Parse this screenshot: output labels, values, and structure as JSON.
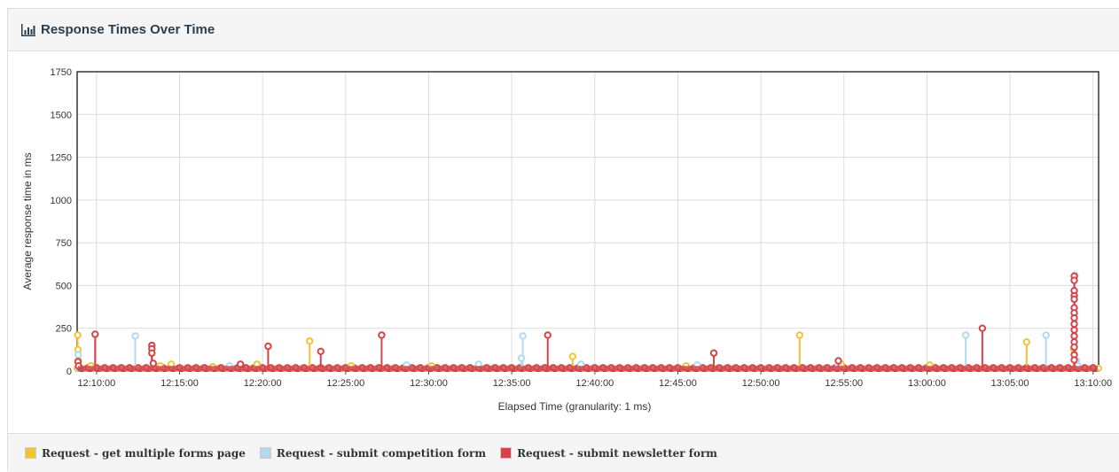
{
  "panel": {
    "title": "Response Times Over Time",
    "title_icon": "bar-chart-icon"
  },
  "chart_data": {
    "type": "line",
    "xlabel": "Elapsed Time (granularity: 1 ms)",
    "ylabel": "Average response time in ms",
    "x_domain": [
      "12:08:50",
      "13:10:20"
    ],
    "ylim": [
      0,
      1750
    ],
    "y_ticks": [
      0,
      250,
      500,
      750,
      1000,
      1250,
      1500,
      1750
    ],
    "x_ticks": [
      "12:10:00",
      "12:15:00",
      "12:20:00",
      "12:25:00",
      "12:30:00",
      "12:35:00",
      "12:40:00",
      "12:45:00",
      "12:50:00",
      "12:55:00",
      "13:00:00",
      "13:05:00",
      "13:10:00"
    ],
    "grid": true,
    "legend_position": "bottom",
    "baseline_value": 20,
    "series": [
      {
        "name": "Request - get multiple forms page",
        "color": "#f0c33a",
        "points": [
          {
            "t": "12:08:52",
            "v": 210
          },
          {
            "t": "12:08:53",
            "v": 125
          },
          {
            "t": "12:08:55",
            "v": 60
          },
          {
            "t": "12:09:40",
            "v": 30
          },
          {
            "t": "12:13:50",
            "v": 30
          },
          {
            "t": "12:14:30",
            "v": 40
          },
          {
            "t": "12:17:00",
            "v": 25
          },
          {
            "t": "12:19:40",
            "v": 40
          },
          {
            "t": "12:22:50",
            "v": 175
          },
          {
            "t": "12:25:20",
            "v": 30
          },
          {
            "t": "12:30:10",
            "v": 30
          },
          {
            "t": "12:38:40",
            "v": 85
          },
          {
            "t": "12:45:30",
            "v": 30
          },
          {
            "t": "12:52:20",
            "v": 210
          },
          {
            "t": "12:54:50",
            "v": 40
          },
          {
            "t": "13:00:10",
            "v": 35
          },
          {
            "t": "13:06:00",
            "v": 170
          },
          {
            "t": "13:08:50",
            "v": 130
          }
        ]
      },
      {
        "name": "Request - submit competition form",
        "color": "#b3d9f0",
        "points": [
          {
            "t": "12:08:54",
            "v": 95
          },
          {
            "t": "12:12:20",
            "v": 205
          },
          {
            "t": "12:18:00",
            "v": 30
          },
          {
            "t": "12:28:40",
            "v": 35
          },
          {
            "t": "12:33:00",
            "v": 40
          },
          {
            "t": "12:35:40",
            "v": 205
          },
          {
            "t": "12:35:35",
            "v": 75
          },
          {
            "t": "12:39:10",
            "v": 40
          },
          {
            "t": "12:46:10",
            "v": 35
          },
          {
            "t": "12:54:40",
            "v": 30
          },
          {
            "t": "13:02:20",
            "v": 210
          },
          {
            "t": "13:07:10",
            "v": 210
          },
          {
            "t": "13:08:55",
            "v": 560
          },
          {
            "t": "13:09:00",
            "v": 60
          },
          {
            "t": "13:09:05",
            "v": 30
          }
        ]
      },
      {
        "name": "Request - submit newsletter form",
        "color": "#d4454a",
        "points": [
          {
            "t": "12:08:53",
            "v": 55
          },
          {
            "t": "12:08:55",
            "v": 30
          },
          {
            "t": "12:09:55",
            "v": 215
          },
          {
            "t": "12:13:20",
            "v": 150
          },
          {
            "t": "12:13:20",
            "v": 130
          },
          {
            "t": "12:13:20",
            "v": 105
          },
          {
            "t": "12:13:25",
            "v": 45
          },
          {
            "t": "12:18:40",
            "v": 40
          },
          {
            "t": "12:20:20",
            "v": 145
          },
          {
            "t": "12:23:30",
            "v": 115
          },
          {
            "t": "12:27:10",
            "v": 210
          },
          {
            "t": "12:37:10",
            "v": 210
          },
          {
            "t": "12:47:10",
            "v": 105
          },
          {
            "t": "12:54:40",
            "v": 60
          },
          {
            "t": "13:03:20",
            "v": 250
          },
          {
            "t": "13:08:52",
            "v": 555
          },
          {
            "t": "13:08:52",
            "v": 530
          },
          {
            "t": "13:08:52",
            "v": 470
          },
          {
            "t": "13:08:52",
            "v": 440
          },
          {
            "t": "13:08:52",
            "v": 420
          },
          {
            "t": "13:08:52",
            "v": 370
          },
          {
            "t": "13:08:52",
            "v": 340
          },
          {
            "t": "13:08:52",
            "v": 310
          },
          {
            "t": "13:08:52",
            "v": 275
          },
          {
            "t": "13:08:52",
            "v": 240
          },
          {
            "t": "13:08:52",
            "v": 205
          },
          {
            "t": "13:08:52",
            "v": 170
          },
          {
            "t": "13:08:52",
            "v": 140
          },
          {
            "t": "13:08:52",
            "v": 95
          },
          {
            "t": "13:08:52",
            "v": 65
          }
        ]
      }
    ]
  },
  "legend": [
    {
      "label": "Request - get multiple forms page",
      "color": "#f0c33a"
    },
    {
      "label": "Request - submit competition form",
      "color": "#b3d9f0"
    },
    {
      "label": "Request - submit newsletter form",
      "color": "#d4454a"
    }
  ]
}
